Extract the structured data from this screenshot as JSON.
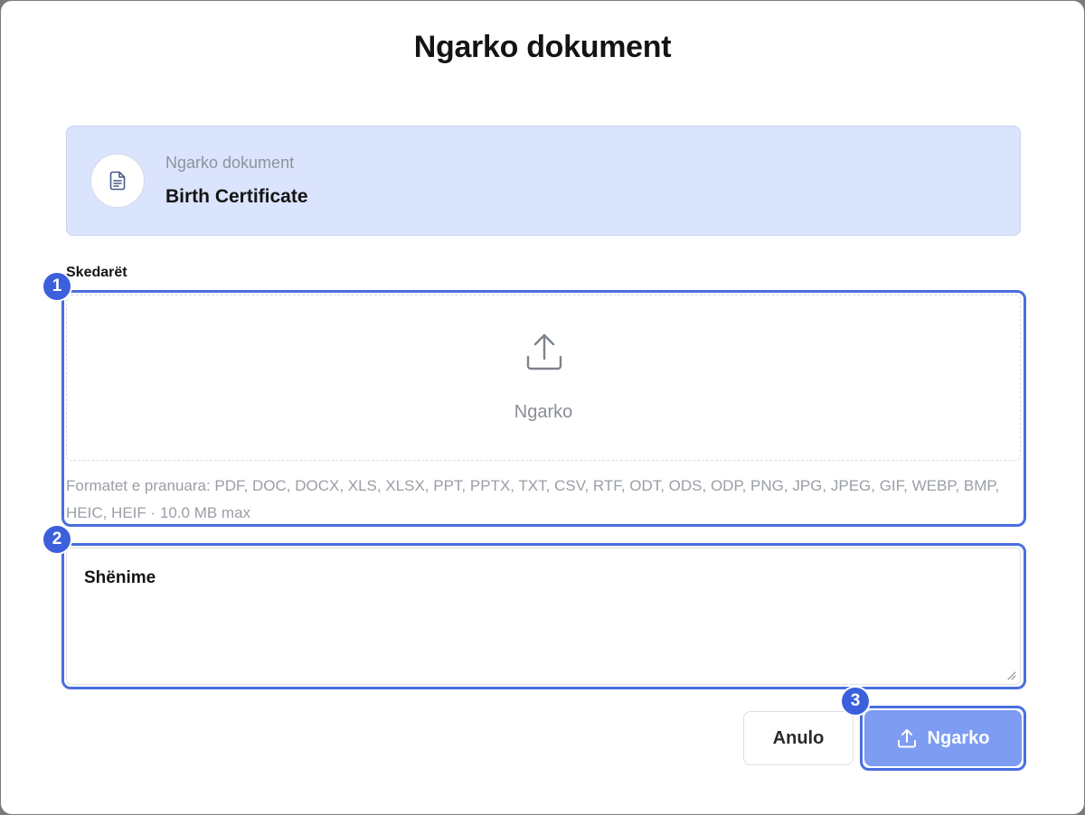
{
  "dialog": {
    "title": "Ngarko dokument"
  },
  "document": {
    "label": "Ngarko dokument",
    "name": "Birth Certificate",
    "icon": "file-text-icon"
  },
  "files": {
    "label": "Skedarët",
    "dropzone_text": "Ngarko",
    "dropzone_icon": "upload-icon",
    "formats_text": "Formatet e pranuara: PDF, DOC, DOCX, XLS, XLSX, PPT, PPTX, TXT, CSV, RTF, ODT, ODS, ODP, PNG, JPG, JPEG, GIF, WEBP, BMP, HEIC, HEIF · 10.0 MB max"
  },
  "notes": {
    "placeholder": "Shënime"
  },
  "buttons": {
    "cancel_label": "Anulo",
    "upload_label": "Ngarko",
    "upload_icon": "upload-icon"
  },
  "annotations": {
    "badges": [
      "1",
      "2",
      "3"
    ],
    "color": "#3c60dc"
  },
  "colors": {
    "accent": "#7d9cf2",
    "card_background": "#dbe4fd"
  }
}
